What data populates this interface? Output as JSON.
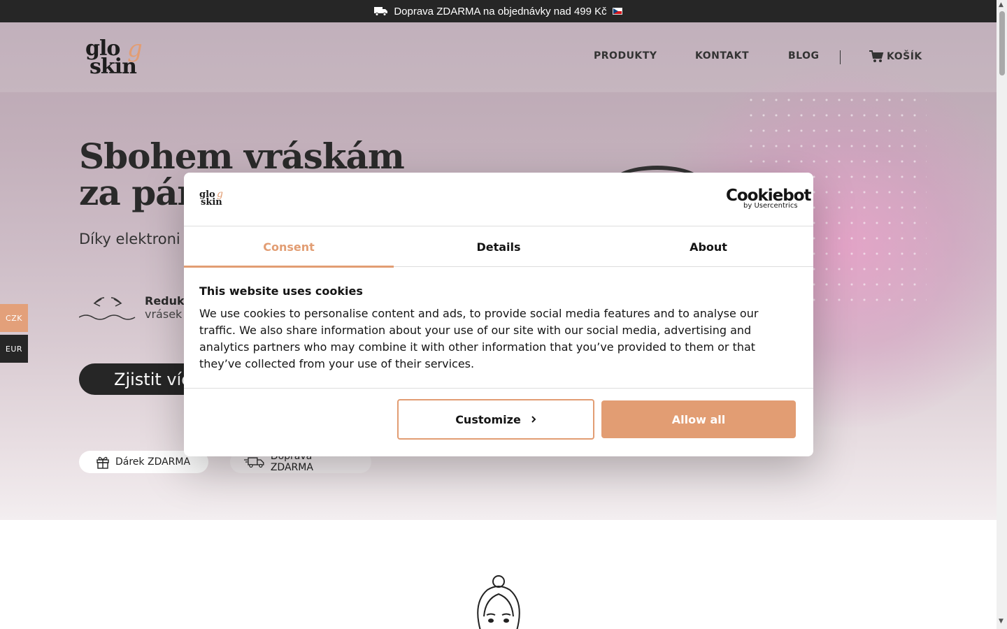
{
  "topbar": {
    "text": "Doprava ZDARMA na objednávky nad 499 Kč",
    "truck_icon": "truck-icon",
    "flag_icon": "czech-flag-icon"
  },
  "header": {
    "logo": {
      "glo": "glo",
      "skin": "skin",
      "g": "g"
    },
    "nav": [
      {
        "label": "PRODUKTY"
      },
      {
        "label": "KONTAKT"
      },
      {
        "label": "BLOG"
      }
    ],
    "cart_label": "KOŠÍK"
  },
  "hero": {
    "headline_line1": "Sbohem vráskám",
    "headline_line2": "za pár",
    "subtitle": "Díky elektroni",
    "feature_title": "Reduk",
    "feature_sub": "vrásek",
    "cta_label": "Zjistit víc",
    "pills": {
      "gift": "Dárek ZDARMA",
      "shipping": "Doprava ZDARMA"
    }
  },
  "currency": {
    "czk": "CZK",
    "eur": "EUR"
  },
  "cookie_dialog": {
    "logo": {
      "glo": "glo",
      "skin": "skin",
      "g": "g"
    },
    "brand": "Cookiebot",
    "brand_sub": "by Usercentrics",
    "tabs": [
      {
        "label": "Consent"
      },
      {
        "label": "Details"
      },
      {
        "label": "About"
      }
    ],
    "active_tab": "Consent",
    "title": "This website uses cookies",
    "body": "We use cookies to personalise content and ads, to provide social media features and to analyse our traffic. We also share information about your use of our site with our social media, advertising and analytics partners who may combine it with other information that you’ve provided to them or that they’ve collected from your use of their services.",
    "customize_label": "Customize",
    "allow_all_label": "Allow all"
  },
  "colors": {
    "accent": "#e29d73",
    "dark": "#262626"
  }
}
